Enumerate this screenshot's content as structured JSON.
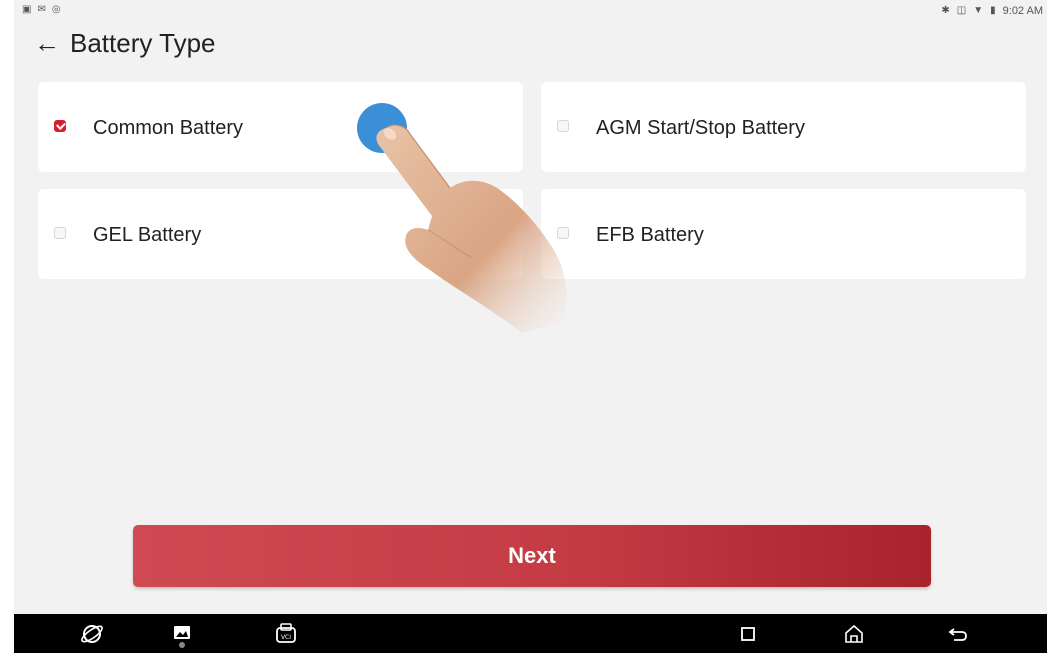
{
  "status_bar": {
    "time": "9:02 AM",
    "left_icons": [
      "gallery-notification-icon",
      "message-notification-icon",
      "bluetooth-notification-icon"
    ],
    "right_icons": [
      "bluetooth-icon",
      "vibrate-icon",
      "wifi-icon",
      "battery-icon"
    ]
  },
  "header": {
    "back_icon": "arrow-left-icon",
    "title": "Battery Type"
  },
  "options": [
    {
      "label": "Common Battery",
      "checked": true
    },
    {
      "label": "AGM Start/Stop Battery",
      "checked": false
    },
    {
      "label": "GEL Battery",
      "checked": false
    },
    {
      "label": "EFB Battery",
      "checked": false
    }
  ],
  "next_button": {
    "label": "Next"
  },
  "nav_bar": {
    "icons": [
      "browser-icon",
      "gallery-icon",
      "vci-icon",
      "recent-apps-icon",
      "home-icon",
      "back-icon"
    ]
  },
  "colors": {
    "accent": "#d3202f",
    "button_start": "#cf4a52",
    "button_end": "#a8232c",
    "background": "#f2f2f2",
    "card": "#ffffff",
    "tap_indicator": "#3b8fd6"
  }
}
